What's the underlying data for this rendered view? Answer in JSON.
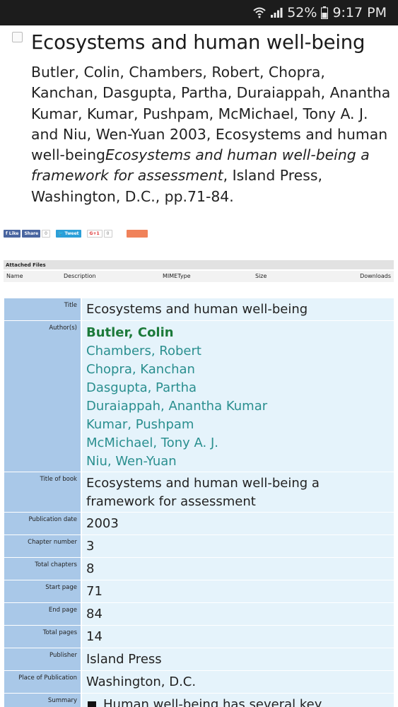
{
  "status_bar": {
    "battery": "52%",
    "time": "9:17 PM"
  },
  "page": {
    "title": "Ecosystems and human well-being",
    "citation": {
      "authors_text": "Butler, Colin, Chambers, Robert, Chopra, Kanchan, Dasgupta, Partha, Duraiappah, Anantha Kumar, Kumar, Pushpam, McMichael, Tony A. J. and Niu, Wen-Yuan 2003, Ecosystems and human well-being",
      "book_title": "Ecosystems and human well-being a framework for assessment",
      "tail": ", Island Press, Washington, D.C., pp.71-84."
    }
  },
  "share": {
    "like": "Like",
    "share": "Share",
    "share_count": "0",
    "tweet": "Tweet",
    "gplus": "G+1",
    "gplus_count": "0",
    "colors": {
      "facebook": "#4a66a0",
      "twitter": "#2b9fd8",
      "orange": "#f0825a"
    }
  },
  "attached_files": {
    "header": "Attached Files",
    "columns": [
      "Name",
      "Description",
      "MIMEType",
      "Size",
      "Downloads"
    ]
  },
  "details": {
    "title_label": "Title",
    "title_value": "Ecosystems and human well-being",
    "authors_label": "Author(s)",
    "authors": [
      "Butler, Colin",
      "Chambers, Robert",
      "Chopra, Kanchan",
      "Dasgupta, Partha",
      "Duraiappah, Anantha Kumar",
      "Kumar, Pushpam",
      "McMichael, Tony A. J.",
      "Niu, Wen-Yuan"
    ],
    "book_label": "Title of book",
    "book_value": "Ecosystems and human well-being a framework for assessment",
    "pubdate_label": "Publication date",
    "pubdate_value": "2003",
    "chapter_label": "Chapter number",
    "chapter_value": "3",
    "total_chapters_label": "Total chapters",
    "total_chapters_value": "8",
    "start_label": "Start page",
    "start_value": "71",
    "end_label": "End page",
    "end_value": "84",
    "total_pages_label": "Total pages",
    "total_pages_value": "14",
    "publisher_label": "Publisher",
    "publisher_value": "Island Press",
    "place_label": "Place of Publication",
    "place_value": "Washington, D.C.",
    "summary_label": "Summary",
    "summary_value": "Human well-being has several key"
  }
}
